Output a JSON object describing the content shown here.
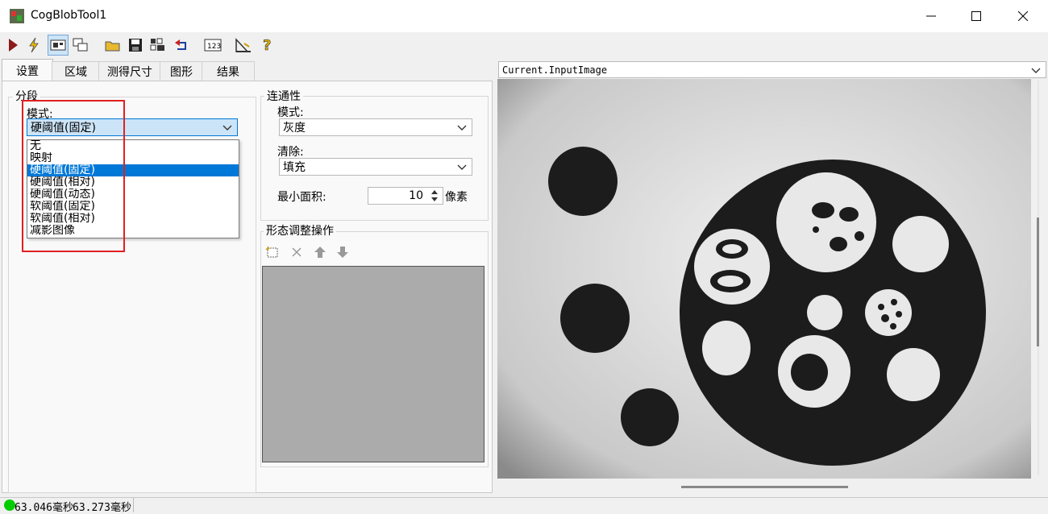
{
  "window": {
    "title": "CogBlobTool1"
  },
  "tabs": [
    {
      "label": "设置"
    },
    {
      "label": "区域"
    },
    {
      "label": "测得尺寸"
    },
    {
      "label": "图形"
    },
    {
      "label": "结果"
    }
  ],
  "segmentation": {
    "group_title": "分段",
    "mode_label": "模式:",
    "mode_value": "硬阈值(固定)",
    "options": [
      "无",
      "映射",
      "硬阈值(固定)",
      "硬阈值(相对)",
      "硬阈值(动态)",
      "软阈值(固定)",
      "软阈值(相对)",
      "减影图像"
    ],
    "selected_index": 2
  },
  "connectivity": {
    "group_title": "连通性",
    "mode_label": "模式:",
    "mode_value": "灰度",
    "clear_label": "清除:",
    "clear_value": "填充",
    "min_area_label": "最小面积:",
    "min_area_value": "10",
    "min_area_unit": "像素"
  },
  "morphology": {
    "group_title": "形态调整操作"
  },
  "display": {
    "image_selector": "Current.InputImage"
  },
  "status": {
    "time1": "63.046毫秒",
    "time2": "63.273毫秒"
  },
  "colors": {
    "selection": "#0078d7",
    "highlight_box": "#e02020",
    "status_ok": "#00cc00"
  }
}
